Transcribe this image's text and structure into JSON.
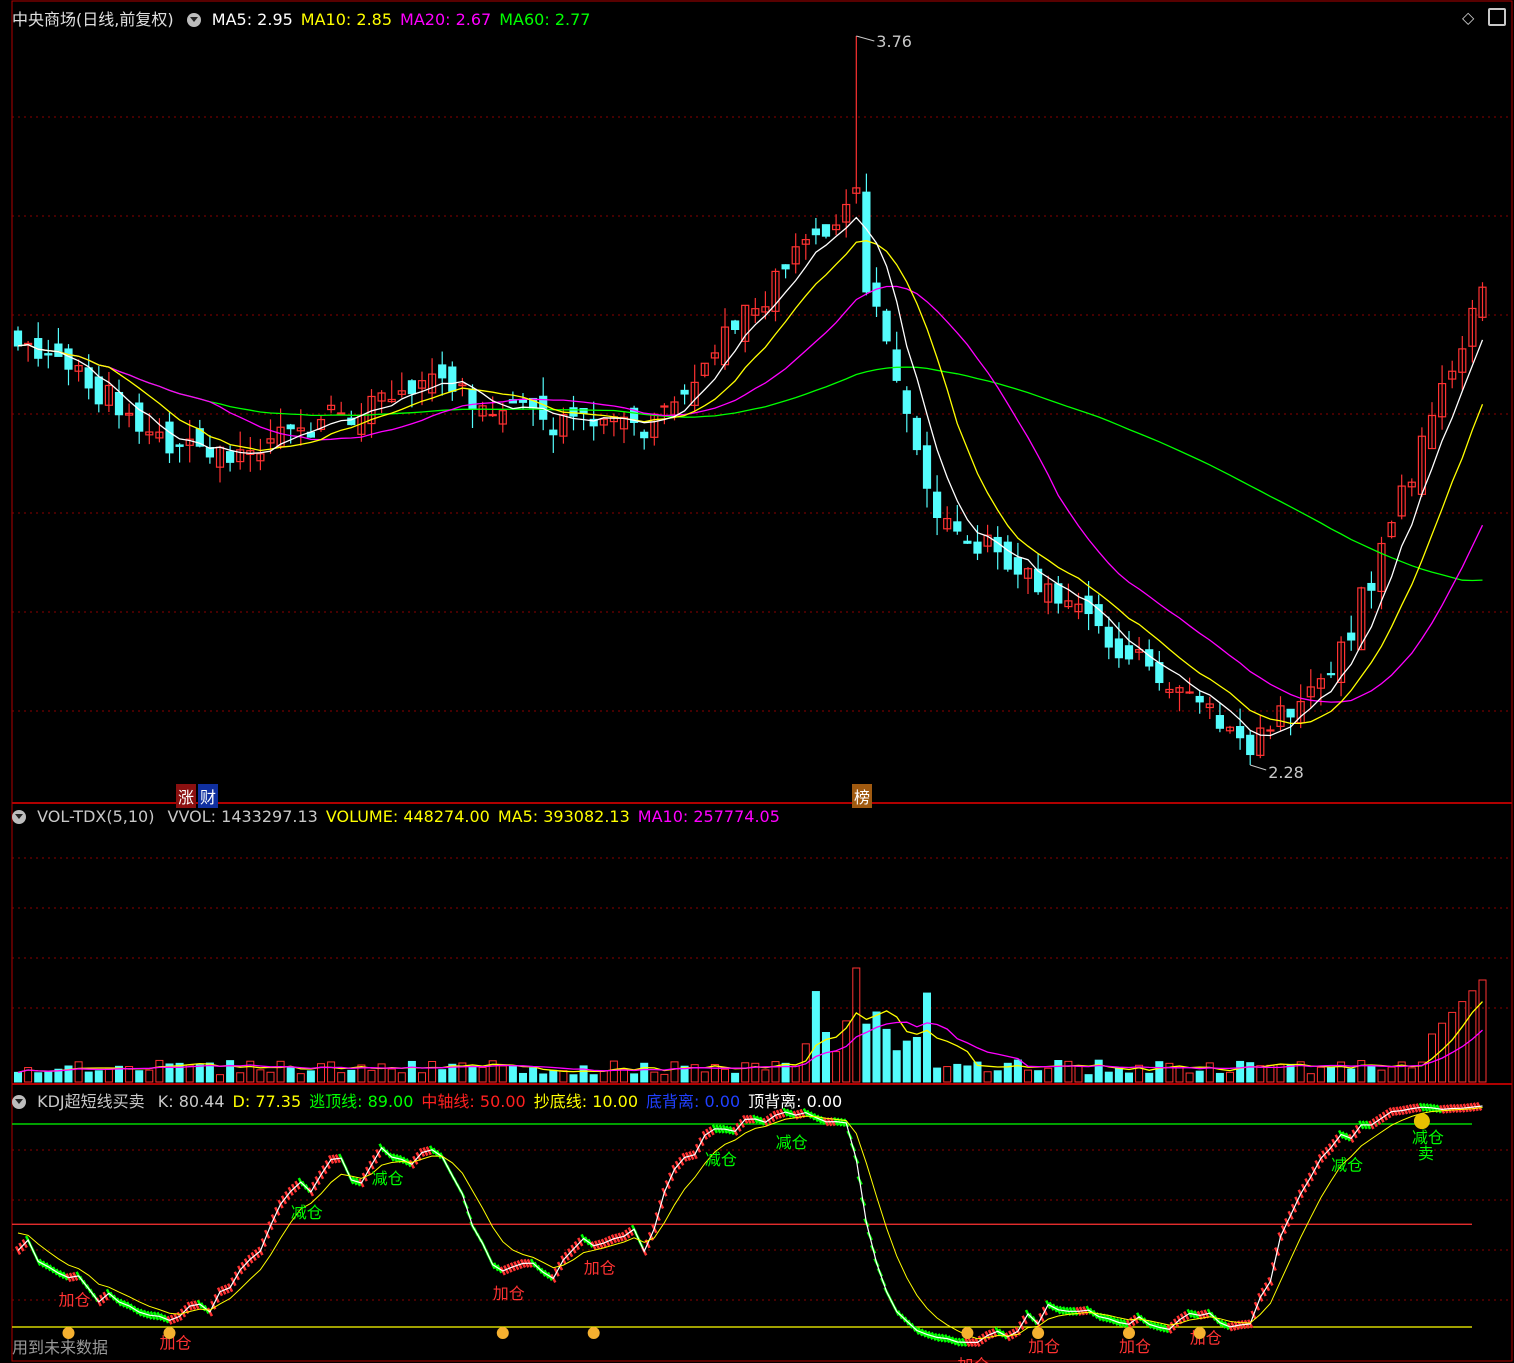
{
  "price_panel": {
    "stock_name": "中央商场(日线,前复权)",
    "indicators": [
      {
        "label": "MA5: 2.95",
        "color": "#ffffff"
      },
      {
        "label": "MA10: 2.85",
        "color": "#ffff00"
      },
      {
        "label": "MA20: 2.67",
        "color": "#ff00ff"
      },
      {
        "label": "MA60: 2.77",
        "color": "#00ff00"
      }
    ],
    "high_label": "3.76",
    "low_label": "2.28",
    "markers": {
      "zhang": "涨",
      "cai": "财",
      "bang": "榜"
    }
  },
  "volume_panel": {
    "name": "VOL-TDX(5,10)",
    "indicators": [
      {
        "label": "VVOL: 1433297.13",
        "color": "#c8c8c8"
      },
      {
        "label": "VOLUME: 448274.00",
        "color": "#ffff00"
      },
      {
        "label": "MA5: 393082.13",
        "color": "#ffff00"
      },
      {
        "label": "MA10: 257774.05",
        "color": "#ff00ff"
      }
    ]
  },
  "kdj_panel": {
    "name": "KDJ超短线买卖",
    "indicators": [
      {
        "label": "K: 80.44",
        "color": "#c8c8c8"
      },
      {
        "label": "D: 77.35",
        "color": "#ffff00"
      },
      {
        "label": "逃顶线: 89.00",
        "color": "#00ff00"
      },
      {
        "label": "中轴线: 50.00",
        "color": "#ff2020"
      },
      {
        "label": "抄底线: 10.00",
        "color": "#ffff00"
      },
      {
        "label": "底背离: 0.00",
        "color": "#2040ff"
      },
      {
        "label": "顶背离: 0.00",
        "color": "#ffffff"
      }
    ],
    "signals": {
      "reduce": "减仓",
      "add": "加仓",
      "sell": "卖"
    },
    "footer": "用到未来数据"
  },
  "colors": {
    "up": "#ff3232",
    "down": "#54fcfc",
    "ma5": "#ffffff",
    "ma10": "#ffff00",
    "ma20": "#ff00ff",
    "ma60": "#00ff00",
    "grid": "#8b0000",
    "border": "#b00000"
  },
  "chart_data": [
    {
      "type": "candlestick",
      "title": "中央商场(日线,前复权)",
      "ylim": [
        2.2,
        3.8
      ],
      "annotations": [
        {
          "label": "3.76",
          "value": 3.76
        },
        {
          "label": "2.28",
          "value": 2.28
        }
      ],
      "key_points": {
        "index": [
          0,
          18,
          42,
          52,
          62,
          83,
          84,
          91,
          122,
          130,
          145
        ],
        "close": [
          3.15,
          2.9,
          3.05,
          2.98,
          2.95,
          3.45,
          3.25,
          2.8,
          2.33,
          2.45,
          3.25
        ]
      }
    },
    {
      "type": "bar",
      "title": "VOL-TDX(5,10)",
      "series": [
        {
          "name": "VOLUME",
          "last": 448274.0
        },
        {
          "name": "MA5",
          "last": 393082.13
        },
        {
          "name": "MA10",
          "last": 257774.05
        }
      ]
    },
    {
      "type": "line",
      "title": "KDJ超短线买卖",
      "ylim": [
        0,
        100
      ],
      "levels": {
        "逃顶线": 89.0,
        "中轴线": 50.0,
        "抄底线": 10.0
      },
      "series": [
        {
          "name": "K",
          "last": 80.44
        },
        {
          "name": "D",
          "last": 77.35
        }
      ]
    }
  ]
}
